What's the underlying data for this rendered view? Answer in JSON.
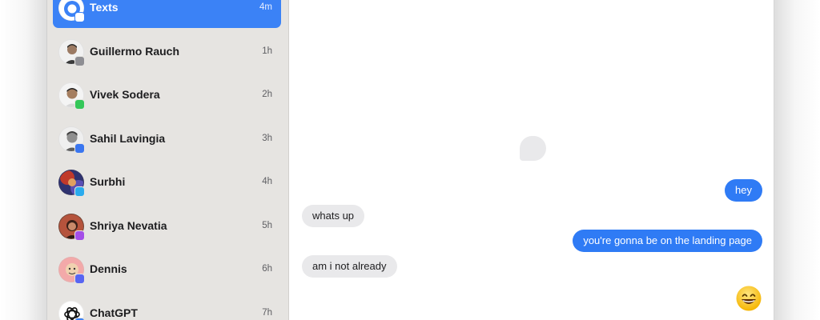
{
  "sidebar": {
    "items": [
      {
        "name": "Texts",
        "time": "4m",
        "avatar_icon": "beeper-texts-icon",
        "badge_icon": "texts-app-icon",
        "badge_color": "#ffffff"
      },
      {
        "name": "Guillermo Rauch",
        "time": "1h",
        "avatar_icon": "person-avatar",
        "badge_icon": "imessage-app-icon",
        "badge_color": "#8e8e93"
      },
      {
        "name": "Vivek Sodera",
        "time": "2h",
        "avatar_icon": "person-avatar",
        "badge_icon": "whatsapp-app-icon",
        "badge_color": "#34c759"
      },
      {
        "name": "Sahil Lavingia",
        "time": "3h",
        "avatar_icon": "person-avatar",
        "badge_icon": "signal-app-icon",
        "badge_color": "#3a76f0"
      },
      {
        "name": "Surbhi",
        "time": "4h",
        "avatar_icon": "person-avatar",
        "badge_icon": "telegram-app-icon",
        "badge_color": "#2aabee"
      },
      {
        "name": "Shriya Nevatia",
        "time": "5h",
        "avatar_icon": "person-avatar",
        "badge_icon": "messenger-app-icon",
        "badge_color": "#a44ee8"
      },
      {
        "name": "Dennis",
        "time": "6h",
        "avatar_icon": "person-avatar",
        "badge_icon": "discord-app-icon",
        "badge_color": "#5865f2"
      },
      {
        "name": "ChatGPT",
        "time": "7h",
        "avatar_icon": "openai-logo-icon",
        "badge_icon": "app-icon",
        "badge_color": "#3b82f6"
      }
    ]
  },
  "chat": {
    "messages": [
      {
        "direction": "outgoing",
        "text": "hey"
      },
      {
        "direction": "incoming",
        "text": "whats up"
      },
      {
        "direction": "outgoing",
        "text": "you're gonna be on the landing page"
      },
      {
        "direction": "incoming",
        "text": "am i not already"
      },
      {
        "direction": "outgoing",
        "text": "😄",
        "emoji_icon": "grinning-face-emoji"
      }
    ]
  },
  "colors": {
    "sidebar_bg": "#e6e4e1",
    "accent": "#3b82f6",
    "outgoing_bubble": "#2f7bf5",
    "incoming_bubble": "#e9e9eb"
  }
}
